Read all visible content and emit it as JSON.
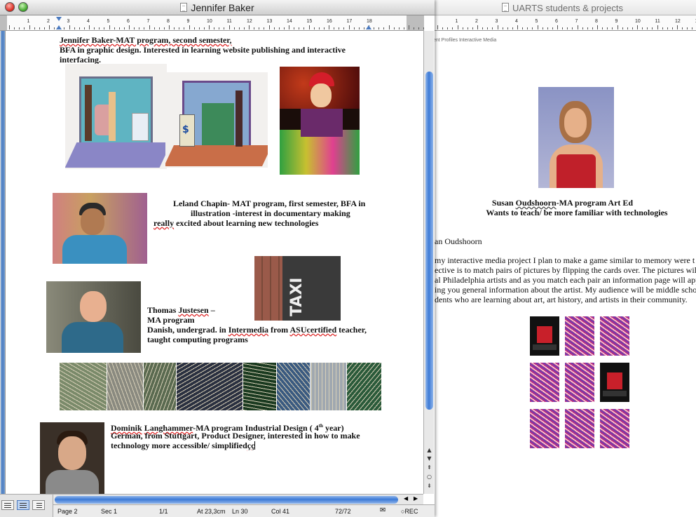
{
  "window_left": {
    "title": "Jennifer Baker",
    "ruler_numbers": [
      "1",
      "2",
      "3",
      "4",
      "5",
      "6",
      "7",
      "8",
      "9",
      "10",
      "11",
      "12",
      "13",
      "14",
      "15",
      "16",
      "17",
      "18"
    ],
    "paragraphs": {
      "jennifer_l1": "Jennifer Baker-MAT program, second semester,",
      "jennifer_l2": "BFA in graphic design.  Interested in learning website publishing and interactive",
      "jennifer_l3": "interfacing.",
      "leland_l1": "Leland Chapin- MAT program, first semester, BFA in",
      "leland_l2": "illustration -interest in documentary making",
      "leland_l3a": "really",
      "leland_l3b": " excited about learning new technologies",
      "thomas_l1a": "Thomas ",
      "thomas_l1b": "Justesen",
      "thomas_l1c": " –",
      "thomas_l2": "MA program",
      "thomas_l3a": "Danish, undergrad. in ",
      "thomas_l3b": "Intermedia",
      "thomas_l3c": " from ",
      "thomas_l3d": "ASUcertified",
      "thomas_l3e": " teacher,",
      "thomas_l4": "taught computing programs",
      "dominik_l1a": "Dominik",
      "dominik_l1b": " ",
      "dominik_l1c": "Langhammer",
      "dominik_l1d": "-MA program  Industrial Design ( 4",
      "dominik_l1sup": "th",
      "dominik_l1e": " year)",
      "dominik_l2": "German, from Stuttgart, Product Designer, interested in how to make",
      "dominik_l3a": "technology more accessible/ simplified",
      "dominik_l3b": "çç"
    },
    "status": {
      "page": "Page  2",
      "sec": "Sec  1",
      "pages": "1/1",
      "at": "At  23,3cm",
      "ln": "Ln  30",
      "col": "Col  41",
      "count": "72/72",
      "rec": "REC"
    },
    "colors": {
      "accent": "#3d7ad6",
      "spell": "#d22222"
    }
  },
  "window_right": {
    "title": "UARTS students & projects",
    "ruler_numbers": [
      "1",
      "2",
      "3",
      "4",
      "5",
      "6",
      "7",
      "8",
      "9",
      "10",
      "11",
      "12",
      "13"
    ],
    "header_text": "ent Profiles Interactive Media",
    "caption_l1a": "Susan ",
    "caption_l1b": "Oudshoorn",
    "caption_l1c": "-MA program Art Ed",
    "caption_l2": "Wants to teach/ be more familiar with technologies",
    "name": "an Oudshoorn",
    "body": [
      "my interactive media project I plan to make a game similar to memory were t",
      "ective is to match pairs of pictures by flipping the cards over.  The pictures wil",
      "al Philadelphia artists and as you match each pair an information page will app",
      "ing you general information about the artist.  My audience will be middle scho",
      "dents who are learning about art, art history, and artists in their community."
    ],
    "cards": [
      "love",
      "scribble",
      "scribble",
      "scribble",
      "scribble",
      "love",
      "scribble",
      "scribble",
      "scribble"
    ]
  }
}
